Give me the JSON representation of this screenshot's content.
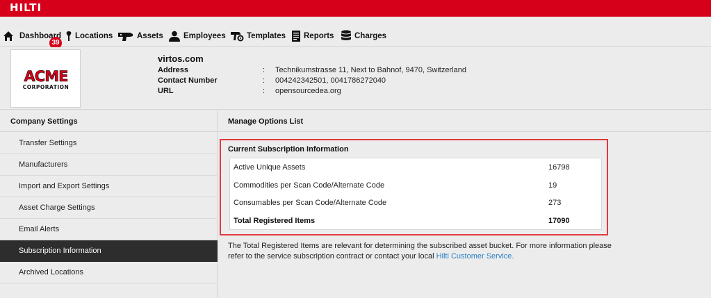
{
  "brand": {
    "logo_text": "HILTI",
    "primary_color": "#d7001a"
  },
  "nav": {
    "dashboard_badge": "39",
    "items": [
      {
        "label": "Dashboard",
        "icon": "home-icon"
      },
      {
        "label": "Locations",
        "icon": "location-pin-icon"
      },
      {
        "label": "Assets",
        "icon": "drill-icon"
      },
      {
        "label": "Employees",
        "icon": "person-icon"
      },
      {
        "label": "Templates",
        "icon": "template-gear-icon"
      },
      {
        "label": "Reports",
        "icon": "report-document-icon"
      },
      {
        "label": "Charges",
        "icon": "database-stack-icon"
      }
    ]
  },
  "company": {
    "logo_line1": "ACME",
    "logo_line2": "CORPORATION",
    "name": "virtos.com",
    "separator": ":",
    "fields": [
      {
        "key": "Address",
        "value": "Technikumstrasse 11, Next to Bahnof, 9470, Switzerland"
      },
      {
        "key": "Contact Number",
        "value": "004242342501, 0041786272040"
      },
      {
        "key": "URL",
        "value": "opensourcedea.org"
      }
    ]
  },
  "sidebar": {
    "title": "Company Settings",
    "items": [
      {
        "label": "Transfer Settings"
      },
      {
        "label": "Manufacturers"
      },
      {
        "label": "Import and Export Settings"
      },
      {
        "label": "Asset Charge Settings"
      },
      {
        "label": "Email Alerts"
      },
      {
        "label": "Subscription Information",
        "active": true
      },
      {
        "label": "Archived Locations"
      }
    ]
  },
  "main": {
    "title": "Manage Options List",
    "subscription": {
      "title": "Current Subscription Information",
      "rows": [
        {
          "label": "Active Unique Assets",
          "value": "16798"
        },
        {
          "label": "Commodities per Scan Code/Alternate Code",
          "value": "19"
        },
        {
          "label": "Consumables per Scan Code/Alternate Code",
          "value": "273"
        },
        {
          "label": "Total Registered Items",
          "value": "17090"
        }
      ]
    },
    "note_text": "The Total Registered Items are relevant for determining the subscribed asset bucket. For more information please refer to the service subscription contract or contact your local",
    "note_link": "Hilti Customer Service."
  }
}
